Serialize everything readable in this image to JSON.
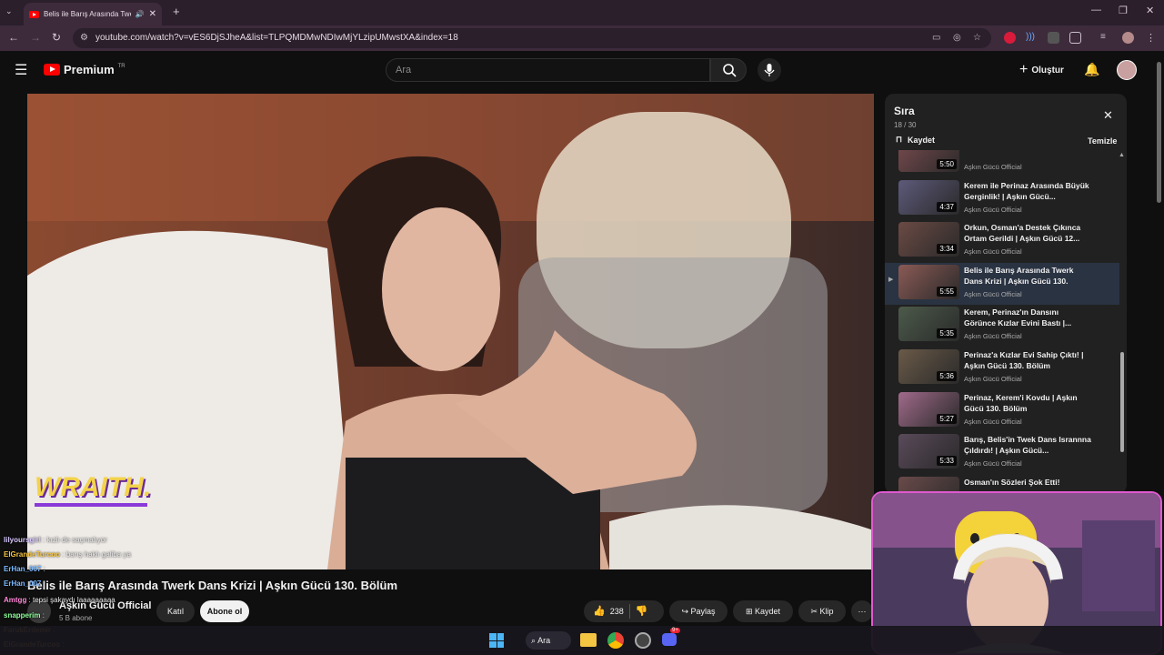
{
  "browser": {
    "tab_title": "Belis ile Barış Arasında Twerk",
    "url": "youtube.com/watch?v=vES6DjSJheA&list=TLPQMDMwNDIwMjYLzipUMwstXA&index=18"
  },
  "header": {
    "logo": "Premium",
    "logo_region": "TR",
    "search_placeholder": "Ara",
    "create_label": "Oluştur"
  },
  "video": {
    "watermark": "WRAITH.",
    "title": "Belis ile Barış Arasında Twerk Dans Krizi | Aşkın Gücü 130. Bölüm",
    "channel": "Aşkın Gücü Official",
    "subscribers": "5 B abone",
    "join_label": "Katıl",
    "subscribe_label": "Abone ol",
    "likes": "238",
    "share_label": "Paylaş",
    "save_label": "Kaydet",
    "clip_label": "Klip"
  },
  "queue": {
    "title": "Sıra",
    "position": "18 / 30",
    "save_label": "Kaydet",
    "clear_label": "Temizle",
    "items": [
      {
        "title": "",
        "channel": "Aşkın Gücü Official",
        "duration": "5:50",
        "thumb": "#7a4b4f"
      },
      {
        "title": "Kerem ile Perinaz Arasında Büyük Gerginlik! | Aşkın Gücü...",
        "channel": "Aşkın Gücü Official",
        "duration": "4:37",
        "thumb": "#5d5a7a"
      },
      {
        "title": "Orkun, Osman'a Destek Çıkınca Ortam Gerildi | Aşkın Gücü 12...",
        "channel": "Aşkın Gücü Official",
        "duration": "3:34",
        "thumb": "#6b4a44"
      },
      {
        "title": "Belis ile Barış Arasında Twerk Dans Krizi | Aşkın Gücü 130. Bölüm",
        "channel": "Aşkın Gücü Official",
        "duration": "5:55",
        "thumb": "#8a5a55",
        "active": true
      },
      {
        "title": "Kerem, Perinaz'ın Dansını Görünce Kızlar Evini Bastı |...",
        "channel": "Aşkın Gücü Official",
        "duration": "5:35",
        "thumb": "#4c5a4a"
      },
      {
        "title": "Perinaz'a Kızlar Evi Sahip Çıktı! | Aşkın Gücü 130. Bölüm",
        "channel": "Aşkın Gücü Official",
        "duration": "5:36",
        "thumb": "#6a5a48"
      },
      {
        "title": "Perinaz, Kerem'i Kovdu | Aşkın Gücü 130. Bölüm",
        "channel": "Aşkın Gücü Official",
        "duration": "5:27",
        "thumb": "#a06a8a"
      },
      {
        "title": "Barış, Belis'in Twek Dans Isrannna Çıldırdı! | Aşkın Gücü...",
        "channel": "Aşkın Gücü Official",
        "duration": "5:33",
        "thumb": "#5a4a5a"
      },
      {
        "title": "Osman'ın Sözleri Şok Etti!",
        "channel": "",
        "duration": "",
        "thumb": "#6a4a4a"
      }
    ]
  },
  "chat": [
    {
      "user": "lilyoursgirl",
      "msg": "kızlı de saçmalıyor",
      "color": "#d8c8ff"
    },
    {
      "user": "ElGrandeTurcoo",
      "msg": "barış haklı galiba ya",
      "color": "#f5c542"
    },
    {
      "user": "ErHan_007",
      "msg": "",
      "color": "#7ab8ff"
    },
    {
      "user": "ErHan_007",
      "msg": "",
      "color": "#7ab8ff"
    },
    {
      "user": "Amtgg",
      "msg": "tepsi şakaydı laaaaaaaaa",
      "color": "#ff8ad8"
    },
    {
      "user": "snapperim",
      "msg": "",
      "color": "#8cff9a"
    },
    {
      "user": "FarukErdemir",
      "msg": "",
      "color": "#f5c542"
    },
    {
      "user": "ElGrandeTurcoo",
      "msg": "",
      "color": "#f5c542"
    }
  ],
  "taskbar": {
    "search_label": "Ara",
    "badge": "9+"
  }
}
